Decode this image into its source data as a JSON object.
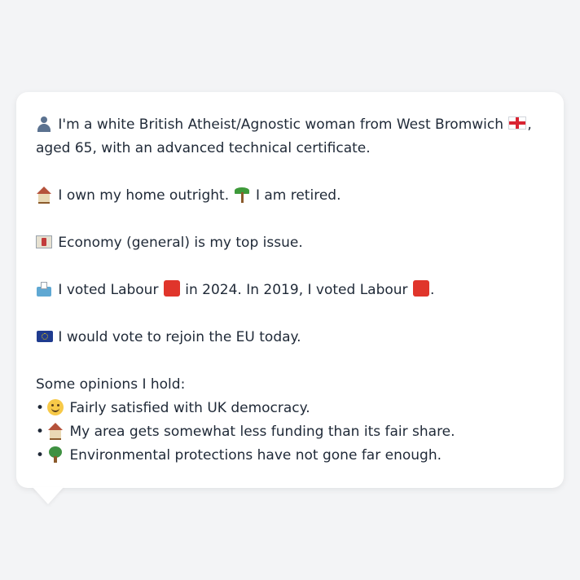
{
  "identity": {
    "icon": "person-silhouette-icon",
    "text_1": "I'm a white British Atheist/Agnostic woman from West Bromwich",
    "flag_icon": "england-flag-icon",
    "text_2": ",",
    "text_3": "aged 65, with an advanced technical certificate."
  },
  "home": {
    "icon": "house-icon",
    "text_1": "I own my home outright.",
    "icon_2": "palm-tree-icon",
    "text_2": "I am retired."
  },
  "issue": {
    "icon": "money-icon",
    "text": "Economy (general) is my top issue."
  },
  "vote": {
    "icon": "ballot-box-icon",
    "text_1": "I voted Labour",
    "party_color": "#e0352b",
    "text_2": "in 2024. In 2019, I voted Labour",
    "text_3": "."
  },
  "eu": {
    "icon": "eu-flag-icon",
    "text": "I would vote to rejoin the EU today."
  },
  "opinions": {
    "heading": "Some opinions I hold:",
    "items": [
      {
        "bullet": "•",
        "icon": "slight-smile-icon",
        "text": "Fairly satisfied with UK democracy."
      },
      {
        "bullet": "•",
        "icon": "house-icon",
        "text": "My area gets somewhat less funding than its fair share."
      },
      {
        "bullet": "•",
        "icon": "tree-icon",
        "text": "Environmental protections have not gone far enough."
      }
    ]
  }
}
